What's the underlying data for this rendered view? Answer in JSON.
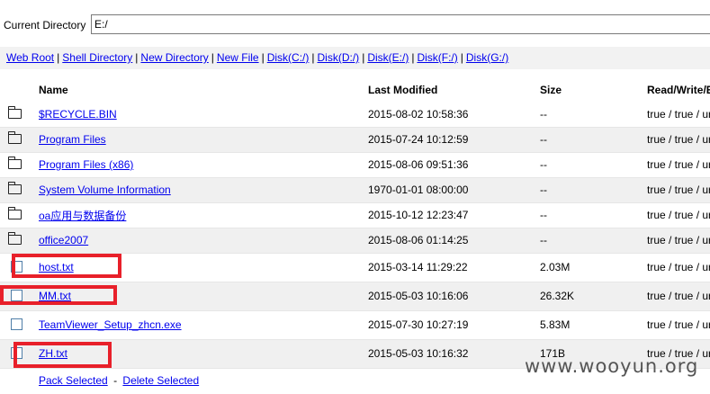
{
  "current_directory": {
    "label": "Current Directory",
    "value": "E:/"
  },
  "nav_links": [
    {
      "name": "web-root-link",
      "label": "Web Root"
    },
    {
      "name": "shell-directory-link",
      "label": "Shell Directory"
    },
    {
      "name": "new-directory-link",
      "label": "New Directory"
    },
    {
      "name": "new-file-link",
      "label": "New File"
    },
    {
      "name": "disk-c-link",
      "label": "Disk(C:/)"
    },
    {
      "name": "disk-d-link",
      "label": "Disk(D:/)"
    },
    {
      "name": "disk-e-link",
      "label": "Disk(E:/)"
    },
    {
      "name": "disk-f-link",
      "label": "Disk(F:/)"
    },
    {
      "name": "disk-g-link",
      "label": "Disk(G:/)"
    }
  ],
  "table": {
    "headers": {
      "name": "Name",
      "modified": "Last Modified",
      "size": "Size",
      "perm": "Read/Write/E"
    },
    "rows": [
      {
        "type": "folder",
        "name": "$RECYCLE.BIN",
        "modified": "2015-08-02 10:58:36",
        "size": "--",
        "perm": "true / true / ur"
      },
      {
        "type": "folder",
        "name": "Program Files",
        "modified": "2015-07-24 10:12:59",
        "size": "--",
        "perm": "true / true / ur"
      },
      {
        "type": "folder",
        "name": "Program Files (x86)",
        "modified": "2015-08-06 09:51:36",
        "size": "--",
        "perm": "true / true / ur"
      },
      {
        "type": "folder",
        "name": "System Volume Information",
        "modified": "1970-01-01 08:00:00",
        "size": "--",
        "perm": "true / true / ur"
      },
      {
        "type": "folder",
        "name": "oa应用与数据备份",
        "modified": "2015-10-12 12:23:47",
        "size": "--",
        "perm": "true / true / ur"
      },
      {
        "type": "folder",
        "name": "office2007",
        "modified": "2015-08-06 01:14:25",
        "size": "--",
        "perm": "true / true / ur"
      },
      {
        "type": "file",
        "name": "host.txt",
        "modified": "2015-03-14 11:29:22",
        "size": "2.03M",
        "perm": "true / true / ur"
      },
      {
        "type": "file",
        "name": "MM.txt",
        "modified": "2015-05-03 10:16:06",
        "size": "26.32K",
        "perm": "true / true / ur"
      },
      {
        "type": "file",
        "name": "TeamViewer_Setup_zhcn.exe",
        "modified": "2015-07-30 10:27:19",
        "size": "5.83M",
        "perm": "true / true / ur"
      },
      {
        "type": "file",
        "name": "ZH.txt",
        "modified": "2015-05-03 10:16:32",
        "size": "171B",
        "perm": "true / true / ur"
      }
    ]
  },
  "footer": {
    "pack_label": "Pack Selected",
    "separator": "-",
    "delete_label": "Delete Selected"
  },
  "watermark": "www.wooyun.org",
  "colors": {
    "link": "#0000ee",
    "highlight_box": "#e8202a",
    "checkbox_border": "#4f7ea8",
    "link_bar_bg": "#f2f2f2"
  }
}
